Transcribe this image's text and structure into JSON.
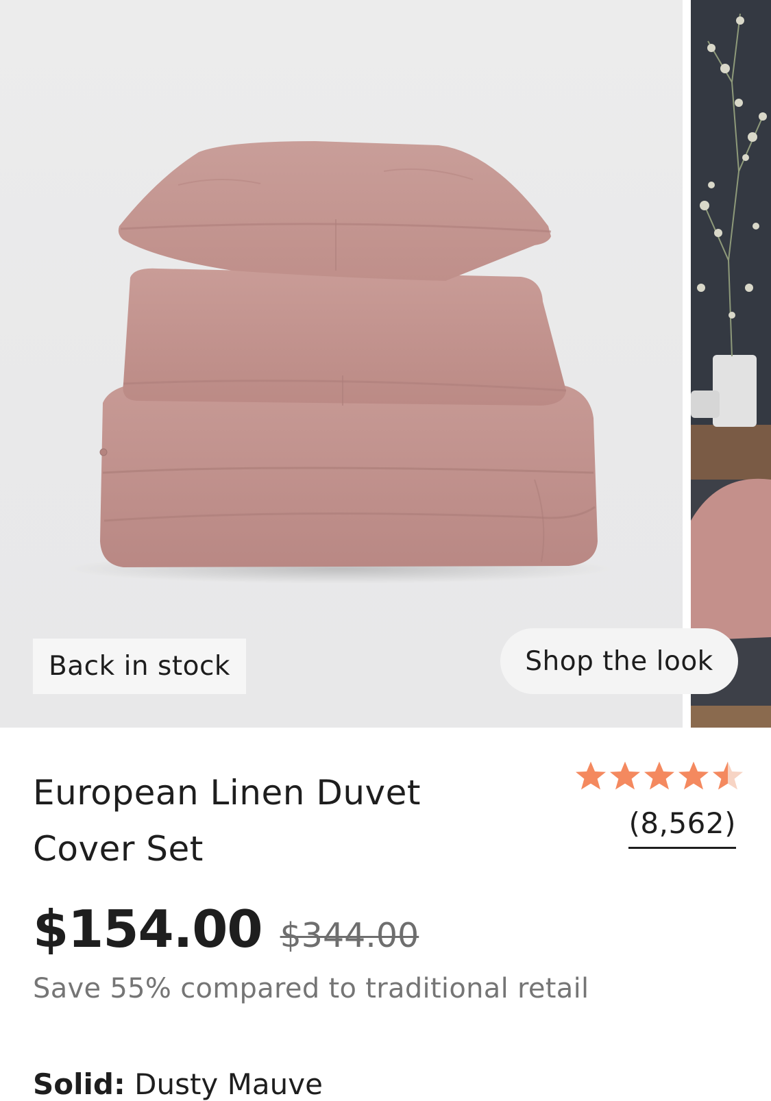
{
  "gallery": {
    "badge": "Back in stock",
    "shop_the_look": "Shop the look"
  },
  "product": {
    "title_line1": "European Linen Duvet",
    "title_line2": "Cover Set",
    "rating": {
      "stars": 4.5,
      "review_count": "(8,562)"
    },
    "price": "$154.00",
    "compare_price": "$344.00",
    "savings": "Save 55% compared to traditional retail",
    "variant_label": "Solid:",
    "variant_value": "Dusty Mauve"
  },
  "colors": {
    "star": "#f4895f",
    "product": "#c99a95"
  }
}
